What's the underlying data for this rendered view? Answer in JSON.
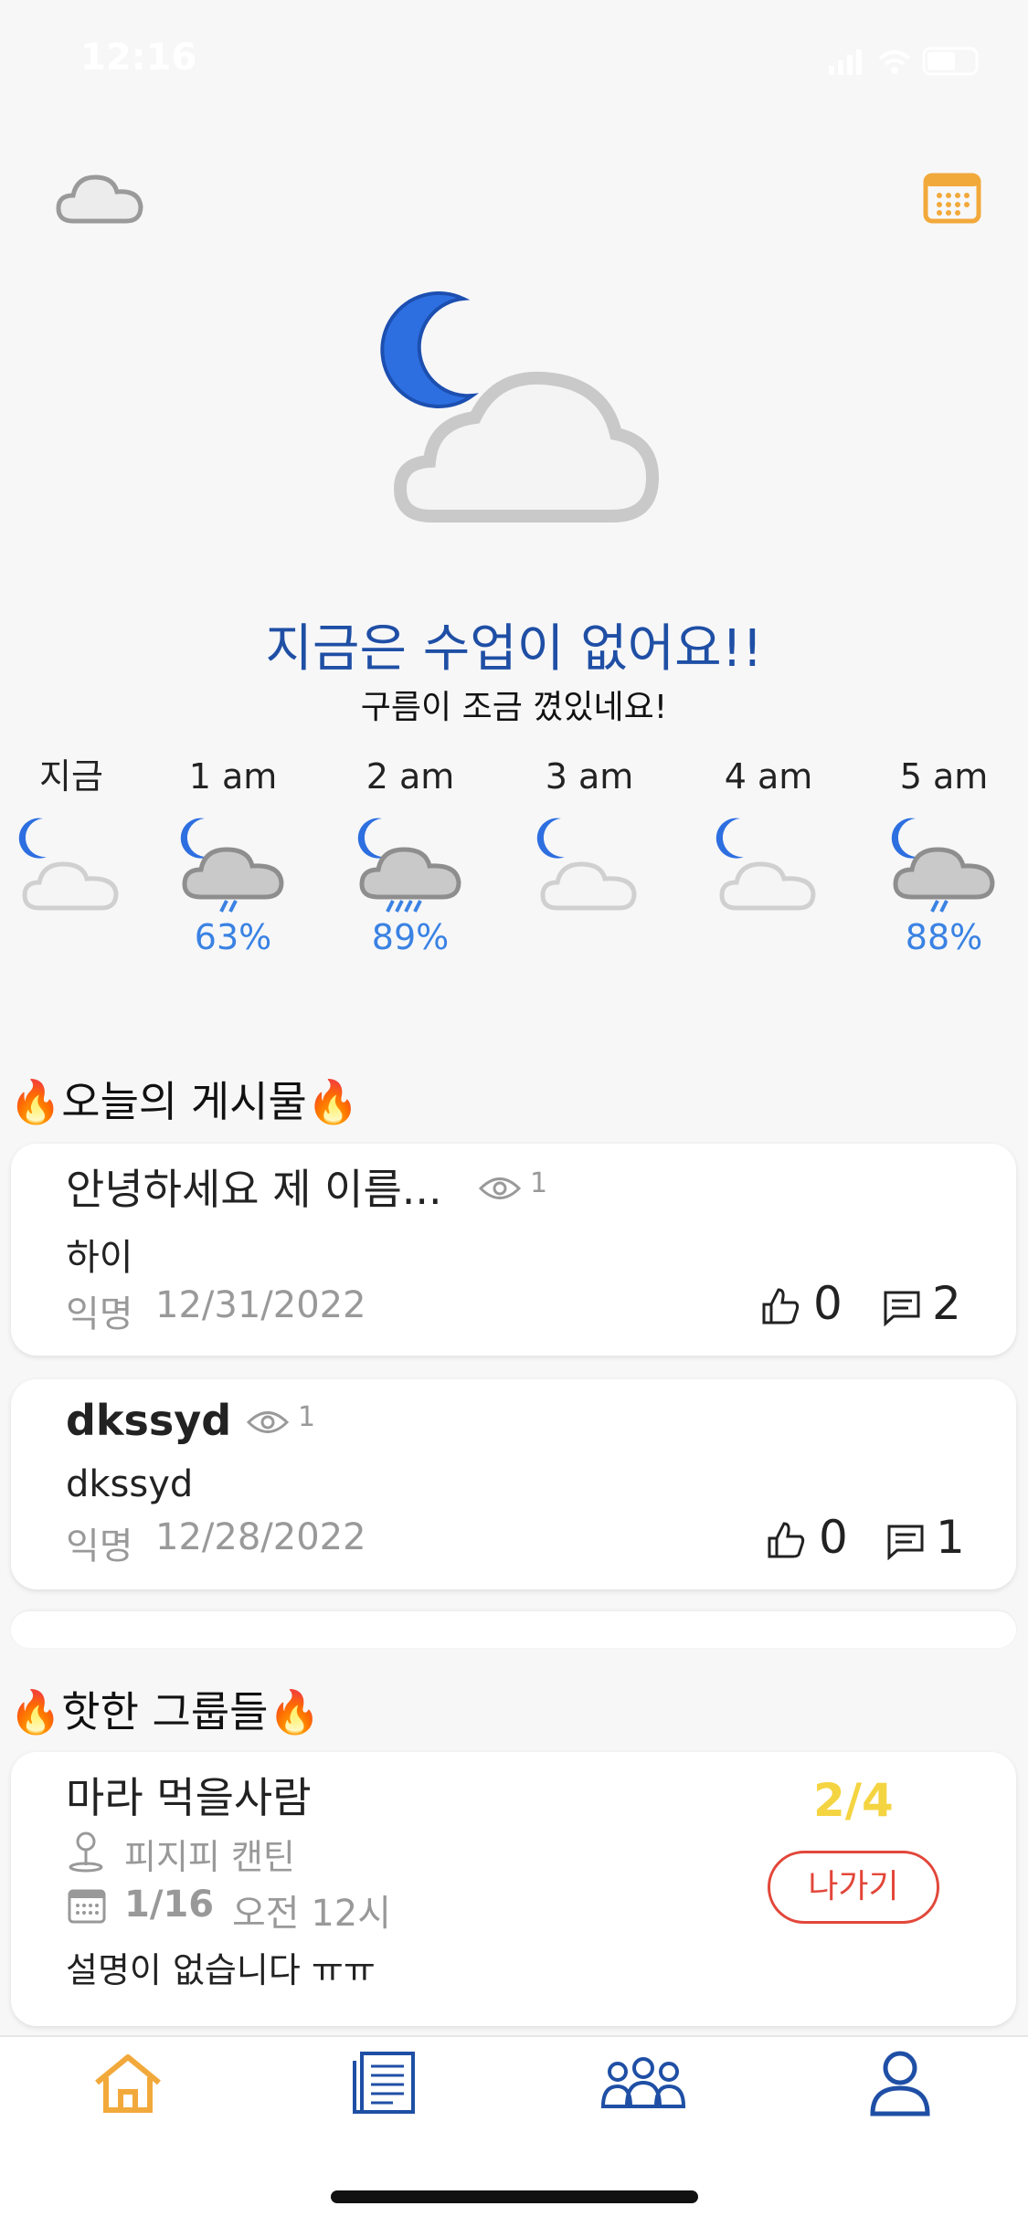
{
  "status_bar": {
    "time": "12:16",
    "battery": "47"
  },
  "header": {
    "weather_icon": "cloud-icon",
    "calendar_icon": "calendar-icon"
  },
  "hero": {
    "icon": "moon-cloud-icon",
    "title": "지금은 수업이 없어요!!",
    "subtitle": "구름이 조금 꼈있네요!"
  },
  "hourly": [
    {
      "label": "지금",
      "icon": "moon-cloud-icon",
      "pop": ""
    },
    {
      "label": "1 am",
      "icon": "moon-rain-cloud-icon",
      "pop": "63%"
    },
    {
      "label": "2 am",
      "icon": "moon-rain-cloud-icon",
      "pop": "89%"
    },
    {
      "label": "3 am",
      "icon": "moon-cloud-icon",
      "pop": ""
    },
    {
      "label": "4 am",
      "icon": "moon-cloud-icon",
      "pop": ""
    },
    {
      "label": "5 am",
      "icon": "moon-rain-cloud-icon",
      "pop": "88%"
    }
  ],
  "posts_section": {
    "title": "오늘의 게시물",
    "posts": [
      {
        "title": "안녕하세요 제 이름...",
        "views": "1",
        "body": "하이",
        "author": "익명",
        "date": "12/31/2022",
        "likes": "0",
        "comments": "2"
      },
      {
        "title": "dkssyd",
        "views": "1",
        "body": "dkssyd",
        "author": "익명",
        "date": "12/28/2022",
        "likes": "0",
        "comments": "1"
      }
    ]
  },
  "groups_section": {
    "title": "핫한 그룹들",
    "group": {
      "title": "마라 먹을사람",
      "location": "피지피 캔틴",
      "date": "1/16",
      "time": "오전 12시",
      "description": "설명이 없습니다 ㅠㅠ",
      "count": "2/4",
      "leave_label": "나가기"
    }
  },
  "tabbar": {
    "tabs": [
      "home-icon",
      "board-icon",
      "groups-icon",
      "profile-icon"
    ],
    "active": "home"
  },
  "colors": {
    "accent": "#f2a93b",
    "primary": "#1f4fa5",
    "rain": "#3a82e3",
    "danger": "#e2473a",
    "count": "#f5d442"
  }
}
